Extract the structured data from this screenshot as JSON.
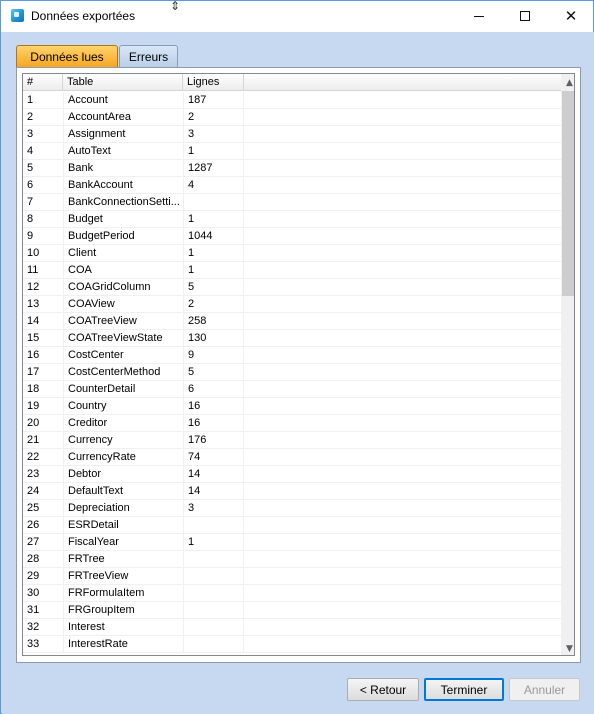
{
  "window": {
    "title": "Données exportées",
    "cursor_glyph": "⇕"
  },
  "tabs": [
    {
      "label": "Données lues",
      "active": true
    },
    {
      "label": "Erreurs",
      "active": false
    }
  ],
  "grid": {
    "columns": [
      "#",
      "Table",
      "Lignes"
    ],
    "rows": [
      {
        "num": "1",
        "table": "Account",
        "lines": "187"
      },
      {
        "num": "2",
        "table": "AccountArea",
        "lines": "2"
      },
      {
        "num": "3",
        "table": "Assignment",
        "lines": "3"
      },
      {
        "num": "4",
        "table": "AutoText",
        "lines": "1"
      },
      {
        "num": "5",
        "table": "Bank",
        "lines": "1287"
      },
      {
        "num": "6",
        "table": "BankAccount",
        "lines": "4"
      },
      {
        "num": "7",
        "table": "BankConnectionSetti...",
        "lines": ""
      },
      {
        "num": "8",
        "table": "Budget",
        "lines": "1"
      },
      {
        "num": "9",
        "table": "BudgetPeriod",
        "lines": "1044"
      },
      {
        "num": "10",
        "table": "Client",
        "lines": "1"
      },
      {
        "num": "11",
        "table": "COA",
        "lines": "1"
      },
      {
        "num": "12",
        "table": "COAGridColumn",
        "lines": "5"
      },
      {
        "num": "13",
        "table": "COAView",
        "lines": "2"
      },
      {
        "num": "14",
        "table": "COATreeView",
        "lines": "258"
      },
      {
        "num": "15",
        "table": "COATreeViewState",
        "lines": "130"
      },
      {
        "num": "16",
        "table": "CostCenter",
        "lines": "9"
      },
      {
        "num": "17",
        "table": "CostCenterMethod",
        "lines": "5"
      },
      {
        "num": "18",
        "table": "CounterDetail",
        "lines": "6"
      },
      {
        "num": "19",
        "table": "Country",
        "lines": "16"
      },
      {
        "num": "20",
        "table": "Creditor",
        "lines": "16"
      },
      {
        "num": "21",
        "table": "Currency",
        "lines": "176"
      },
      {
        "num": "22",
        "table": "CurrencyRate",
        "lines": "74"
      },
      {
        "num": "23",
        "table": "Debtor",
        "lines": "14"
      },
      {
        "num": "24",
        "table": "DefaultText",
        "lines": "14"
      },
      {
        "num": "25",
        "table": "Depreciation",
        "lines": "3"
      },
      {
        "num": "26",
        "table": "ESRDetail",
        "lines": ""
      },
      {
        "num": "27",
        "table": "FiscalYear",
        "lines": "1"
      },
      {
        "num": "28",
        "table": "FRTree",
        "lines": ""
      },
      {
        "num": "29",
        "table": "FRTreeView",
        "lines": ""
      },
      {
        "num": "30",
        "table": "FRFormulaItem",
        "lines": ""
      },
      {
        "num": "31",
        "table": "FRGroupItem",
        "lines": ""
      },
      {
        "num": "32",
        "table": "Interest",
        "lines": ""
      },
      {
        "num": "33",
        "table": "InterestRate",
        "lines": ""
      }
    ]
  },
  "buttons": {
    "back": "< Retour",
    "finish": "Terminer",
    "cancel": "Annuler"
  },
  "colors": {
    "window_bg": "#c6d9f1",
    "active_tab": "#f6a623",
    "accent": "#0078d7"
  }
}
